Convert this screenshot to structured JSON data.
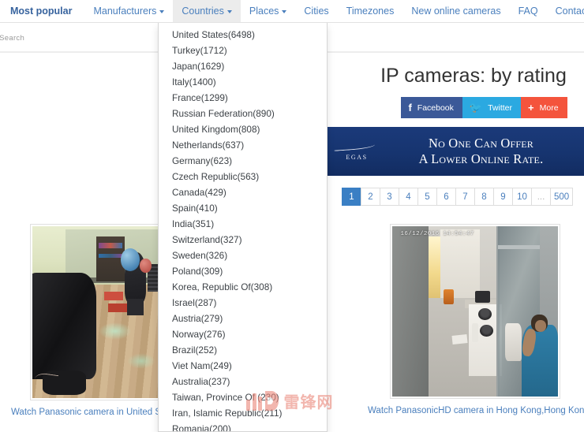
{
  "nav": {
    "items": [
      {
        "label": "Most popular",
        "has_caret": false,
        "state": "bold"
      },
      {
        "label": "Manufacturers",
        "has_caret": true,
        "state": "normal"
      },
      {
        "label": "Countries",
        "has_caret": true,
        "state": "active"
      },
      {
        "label": "Places",
        "has_caret": true,
        "state": "normal"
      },
      {
        "label": "Cities",
        "has_caret": false,
        "state": "normal"
      },
      {
        "label": "Timezones",
        "has_caret": false,
        "state": "normal"
      },
      {
        "label": "New online cameras",
        "has_caret": false,
        "state": "normal"
      },
      {
        "label": "FAQ",
        "has_caret": false,
        "state": "normal"
      },
      {
        "label": "Contacts",
        "has_caret": false,
        "state": "normal"
      }
    ],
    "flag": "us-flag-icon"
  },
  "search_strip": {
    "ghost_text": "m Search"
  },
  "main": {
    "title": "IP cameras: by rating",
    "social": [
      {
        "label": "Facebook",
        "icon": "f",
        "color": "#3b5998"
      },
      {
        "label": "Twitter",
        "icon": "ᵛ",
        "color": "#2ba9e1"
      },
      {
        "label": "More",
        "icon": "+",
        "color": "#f4543c"
      }
    ],
    "banner": {
      "logo_text": "EGAS",
      "line1": "No One Can Offer",
      "line2": "A Lower Online Rate."
    },
    "pagination": {
      "pages": [
        "1",
        "2",
        "3",
        "4",
        "5",
        "6",
        "7",
        "8",
        "9",
        "10",
        "...",
        "500"
      ],
      "current": "1"
    },
    "cameras": [
      {
        "caption": "Watch Panasonic camera in United S",
        "timestamp": "",
        "scene": "gym-interior"
      },
      {
        "caption": "Watch PanasonicHD camera in Hong Kong,Hong Kong",
        "timestamp": "16/12/2016  14:54:47",
        "scene": "corridor-kitchen"
      }
    ]
  },
  "dropdown": {
    "open_for": "Countries",
    "items": [
      {
        "country": "United States",
        "count": "6498",
        "label": "United States(6498)"
      },
      {
        "country": "Turkey",
        "count": "1712",
        "label": "Turkey(1712)"
      },
      {
        "country": "Japan",
        "count": "1629",
        "label": "Japan(1629)"
      },
      {
        "country": "Italy",
        "count": "1400",
        "label": "Italy(1400)"
      },
      {
        "country": "France",
        "count": "1299",
        "label": "France(1299)"
      },
      {
        "country": "Russian Federation",
        "count": "890",
        "label": "Russian Federation(890)"
      },
      {
        "country": "United Kingdom",
        "count": "808",
        "label": "United Kingdom(808)"
      },
      {
        "country": "Netherlands",
        "count": "637",
        "label": "Netherlands(637)"
      },
      {
        "country": "Germany",
        "count": "623",
        "label": "Germany(623)"
      },
      {
        "country": "Czech Republic",
        "count": "563",
        "label": "Czech Republic(563)"
      },
      {
        "country": "Canada",
        "count": "429",
        "label": "Canada(429)"
      },
      {
        "country": "Spain",
        "count": "410",
        "label": "Spain(410)"
      },
      {
        "country": "India",
        "count": "351",
        "label": "India(351)"
      },
      {
        "country": "Switzerland",
        "count": "327",
        "label": "Switzerland(327)"
      },
      {
        "country": "Sweden",
        "count": "326",
        "label": "Sweden(326)"
      },
      {
        "country": "Poland",
        "count": "309",
        "label": "Poland(309)"
      },
      {
        "country": "Korea, Republic Of",
        "count": "308",
        "label": "Korea, Republic Of(308)"
      },
      {
        "country": "Israel",
        "count": "287",
        "label": "Israel(287)"
      },
      {
        "country": "Austria",
        "count": "279",
        "label": "Austria(279)"
      },
      {
        "country": "Norway",
        "count": "276",
        "label": "Norway(276)"
      },
      {
        "country": "Brazil",
        "count": "252",
        "label": "Brazil(252)"
      },
      {
        "country": "Viet Nam",
        "count": "249",
        "label": "Viet Nam(249)"
      },
      {
        "country": "Australia",
        "count": "237",
        "label": "Australia(237)"
      },
      {
        "country": "Taiwan, Province Of",
        "count": "230",
        "label": "Taiwan, Province Of (230)"
      },
      {
        "country": "Iran, Islamic Republic",
        "count": "211",
        "label": "Iran, Islamic Republic(211)"
      },
      {
        "country": "Romania",
        "count": "200",
        "label": "Romania(200)"
      }
    ]
  },
  "watermark": {
    "text": "雷锋网"
  }
}
